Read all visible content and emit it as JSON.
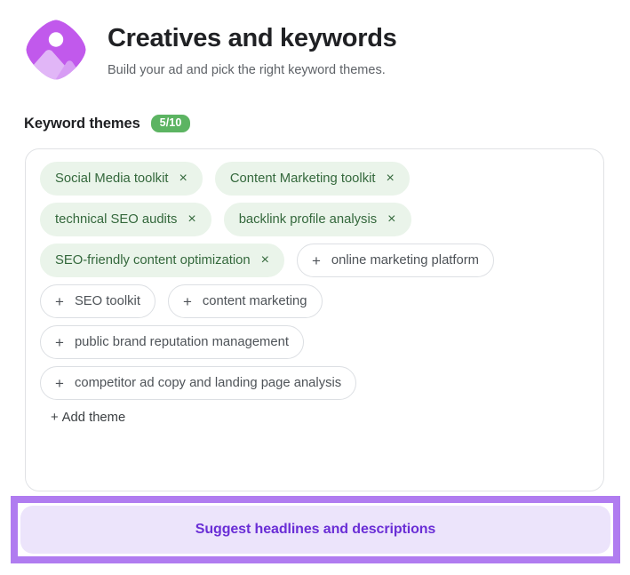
{
  "header": {
    "icon": "image-placeholder-icon",
    "title": "Creatives and keywords",
    "subtitle": "Build your ad and pick the right keyword themes."
  },
  "keyword_themes": {
    "section_title": "Keyword themes",
    "count_badge": "5/10",
    "selected_count": 5,
    "max_count": 10,
    "remove_icon": "×",
    "add_icon": "+",
    "chips": [
      {
        "label": "Social Media toolkit",
        "state": "selected"
      },
      {
        "label": "Content Marketing toolkit",
        "state": "selected"
      },
      {
        "label": "technical SEO audits",
        "state": "selected"
      },
      {
        "label": "backlink profile analysis",
        "state": "selected"
      },
      {
        "label": "SEO-friendly content optimization",
        "state": "selected"
      },
      {
        "label": "online marketing platform",
        "state": "unselected"
      },
      {
        "label": "SEO toolkit",
        "state": "unselected"
      },
      {
        "label": "content marketing",
        "state": "unselected"
      },
      {
        "label": "public brand reputation management",
        "state": "unselected"
      },
      {
        "label": "competitor ad copy and landing page analysis",
        "state": "unselected"
      }
    ],
    "add_theme_label": "Add theme",
    "add_theme_plus": "+"
  },
  "cta": {
    "label": "Suggest headlines and descriptions"
  },
  "colors": {
    "brand_purple": "#b07cf0",
    "cta_text": "#6a2ed6",
    "cta_background": "#ece4fb",
    "badge_green": "#5cb462",
    "chip_selected_bg": "#eaf4ea",
    "chip_selected_text": "#34683c",
    "chip_unselected_border": "#dcdfe3",
    "title_text": "#202124",
    "subtitle_text": "#5f6368"
  }
}
